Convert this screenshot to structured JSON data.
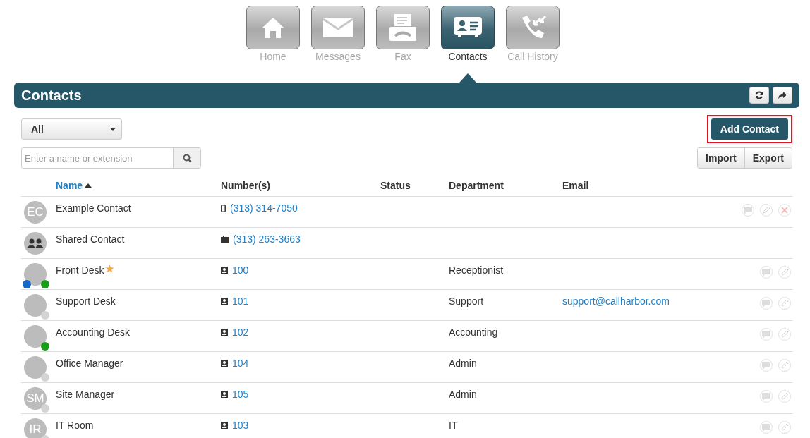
{
  "nav_tabs": [
    {
      "label": "Home",
      "kind": "home",
      "selected": false
    },
    {
      "label": "Messages",
      "kind": "messages",
      "selected": false
    },
    {
      "label": "Fax",
      "kind": "fax",
      "selected": false
    },
    {
      "label": "Contacts",
      "kind": "contacts",
      "selected": true
    },
    {
      "label": "Call History",
      "kind": "history",
      "selected": false
    }
  ],
  "header": {
    "title": "Contacts"
  },
  "filter": {
    "value": "All"
  },
  "search": {
    "placeholder": "Enter a name or extension"
  },
  "add_button": {
    "label": "Add Contact",
    "highlighted": true
  },
  "import_button": "Import",
  "export_button": "Export",
  "table": {
    "columns": [
      {
        "label": "Name",
        "sorted": true
      },
      {
        "label": "Number(s)",
        "sorted": false
      },
      {
        "label": "Status",
        "sorted": false
      },
      {
        "label": "Department",
        "sorted": false
      },
      {
        "label": "Email",
        "sorted": false
      }
    ],
    "rows": [
      {
        "avatar": {
          "kind": "initials",
          "initials": "EC"
        },
        "dots": [],
        "name": "Example Contact",
        "starred": false,
        "number": {
          "kind": "mobile",
          "text": "(313) 314-7050"
        },
        "actions": [
          {
            "kind": "chat"
          },
          {
            "kind": "edit"
          },
          {
            "kind": "delete"
          }
        ]
      },
      {
        "avatar": {
          "kind": "group"
        },
        "dots": [],
        "name": "Shared Contact",
        "starred": false,
        "number": {
          "kind": "work",
          "text": "(313) 263-3663"
        },
        "actions": []
      },
      {
        "avatar": {
          "kind": "blank"
        },
        "dots": [
          {
            "color": "#1468c8"
          },
          {
            "color": "#1a9e1a"
          }
        ],
        "name": "Front Desk",
        "starred": true,
        "number": {
          "kind": "extension",
          "text": "100"
        },
        "department": "Receptionist",
        "actions": [
          {
            "kind": "chat"
          },
          {
            "kind": "edit"
          }
        ]
      },
      {
        "avatar": {
          "kind": "blank"
        },
        "dots": [
          {
            "color": "#d4d4d4"
          }
        ],
        "name": "Support Desk",
        "starred": false,
        "number": {
          "kind": "extension",
          "text": "101"
        },
        "department": "Support",
        "email": "support@callharbor.com",
        "actions": [
          {
            "kind": "chat"
          },
          {
            "kind": "edit"
          }
        ]
      },
      {
        "avatar": {
          "kind": "blank"
        },
        "dots": [
          {
            "color": "#1a9e1a"
          }
        ],
        "name": "Accounting Desk",
        "starred": false,
        "number": {
          "kind": "extension",
          "text": "102"
        },
        "department": "Accounting",
        "actions": [
          {
            "kind": "chat"
          },
          {
            "kind": "edit"
          }
        ]
      },
      {
        "avatar": {
          "kind": "blank"
        },
        "dots": [
          {
            "color": "#d4d4d4"
          }
        ],
        "name": "Office Manager",
        "starred": false,
        "number": {
          "kind": "extension",
          "text": "104"
        },
        "department": "Admin",
        "actions": [
          {
            "kind": "chat"
          },
          {
            "kind": "edit"
          }
        ]
      },
      {
        "avatar": {
          "kind": "initials",
          "initials": "SM"
        },
        "dots": [
          {
            "color": "#d4d4d4"
          }
        ],
        "name": "Site Manager",
        "starred": false,
        "number": {
          "kind": "extension",
          "text": "105"
        },
        "department": "Admin",
        "actions": [
          {
            "kind": "chat"
          },
          {
            "kind": "edit"
          }
        ]
      },
      {
        "avatar": {
          "kind": "initials",
          "initials": "IR"
        },
        "dots": [
          {
            "color": "#d4d4d4"
          }
        ],
        "name": "IT Room",
        "starred": false,
        "number": {
          "kind": "extension",
          "text": "103"
        },
        "department": "IT",
        "actions": [
          {
            "kind": "chat"
          },
          {
            "kind": "edit"
          }
        ]
      }
    ]
  }
}
